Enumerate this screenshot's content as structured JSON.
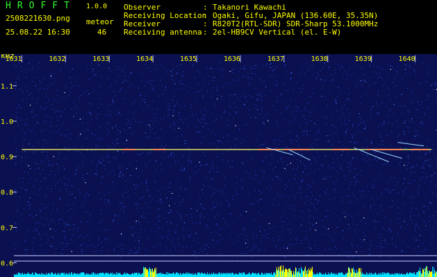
{
  "header": {
    "app_name": "HROFFT",
    "version": "1.0.0",
    "filename": "2508221630.png",
    "timestamp": "25.08.22 16:30",
    "meteor_label": "meteor",
    "meteor_count": "46",
    "fields": [
      {
        "label": "Observer",
        "value": "Takanori Kawachi"
      },
      {
        "label": "Receiving Location",
        "value": "Ogaki, Gifu, JAPAN (136.60E, 35.35N)"
      },
      {
        "label": "Receiver",
        "value": "R820T2(RTL-SDR) SDR-Sharp 53.1000MHz"
      },
      {
        "label": "Receiving antenna",
        "value": "2el-HB9CV Vertical (el. E-W)"
      }
    ]
  },
  "spectrogram": {
    "y_unit": "kHz",
    "y_ticks": [
      "1.1",
      "1.0",
      "0.9",
      "0.8",
      "0.7",
      "0.6"
    ],
    "x_ticks": [
      "1631",
      "1632",
      "1633",
      "1634",
      "1635",
      "1636",
      "1637",
      "1638",
      "1639",
      "1640"
    ],
    "x_range": [
      1630.5,
      1640.5
    ],
    "y_range": [
      0.56,
      1.17
    ],
    "carrier_khz": 0.92,
    "reference_lines_khz": [
      0.62,
      0.605
    ],
    "colors": {
      "background": "#0a1050",
      "noise": "#1e3cb4",
      "label_text": "#ffff00",
      "grid_tick": "#c8c8ff",
      "carrier": "#e0e060",
      "signal_bar": "#00e0ff",
      "signal_peak": "#ffff00"
    }
  }
}
